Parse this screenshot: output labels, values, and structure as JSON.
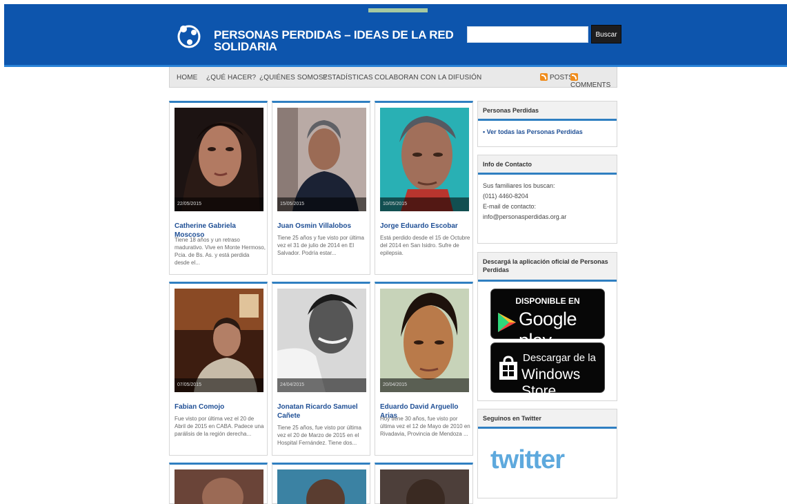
{
  "header": {
    "title": "PERSONAS PERDIDAS – IDEAS DE LA RED SOLIDARIA",
    "search_placeholder": "",
    "search_button": "Buscar"
  },
  "nav": {
    "items": [
      "HOME",
      "¿QUÉ HACER?",
      "¿QUIÉNES SOMOS?",
      "ESTADÍSTICAS",
      "COLABORAN CON LA DIFUSIÓN"
    ],
    "posts": "POSTS",
    "comments": "COMMENTS"
  },
  "cards": [
    {
      "date": "22/05/2015",
      "name": "Catherine Gabriela Moscoso",
      "text": "Tiene 18 años y un retraso madurativo. Vive en Monte Hermoso, Pcia. de Bs. As. y está perdida desde el..."
    },
    {
      "date": "15/05/2015",
      "name": "Juan Osmin Villalobos",
      "text": "Tiene 25 años y fue visto por última vez el 31 de julio de 2014 en El Salvador. Podría estar..."
    },
    {
      "date": "10/05/2015",
      "name": "Jorge Eduardo Escobar",
      "text": "Está perdido desde el 15 de Octubre del 2014 en San Isidro. Sufre de epilepsia."
    },
    {
      "date": "07/05/2015",
      "name": "Fabian Comojo",
      "text": "Fue visto por última vez el 20 de Abril de 2015 en CABA. Padece una parálisis de la región derecha..."
    },
    {
      "date": "24/04/2015",
      "name": "Jonatan Ricardo Samuel Cañete",
      "text": "Tiene 25 años, fue visto por última vez el 20 de Marzo de 2015 en el Hospital Fernández. Tiene dos..."
    },
    {
      "date": "20/04/2015",
      "name": "Eduardo David Arguello Arias",
      "text": "Hoy tiene 30 años, fue visto por última vez el 12 de Mayo de 2010 en Rivadavia, Provincia de Mendoza ..."
    }
  ],
  "sidebar": {
    "lost": {
      "title": "Personas Perdidas",
      "link": "Ver todas las Personas Perdidas"
    },
    "contact": {
      "title": "Info de Contacto",
      "line1": "Sus familiares los buscan:",
      "phone": "(011) 4460-8204",
      "email_label": "E-mail de contacto:",
      "email": "info@personasperdidas.org.ar"
    },
    "app": {
      "title": "Descargá la aplicación oficial de Personas Perdidas",
      "google_top": "DISPONIBLE EN",
      "google_bottom": "Google play",
      "windows_top": "Descargar de la",
      "windows_bottom": "Windows Store"
    },
    "twitter": {
      "title": "Seguinos en Twitter",
      "logo": "twitter"
    }
  },
  "colors": {
    "header": "#0d55ad",
    "accent": "#2f7fc1",
    "link": "#1f4f95",
    "feed": "#f08c1b",
    "twitter": "#5ea9dd"
  },
  "icons": [
    "logo-icon",
    "rss-icon",
    "play-store-icon",
    "windows-store-icon"
  ]
}
